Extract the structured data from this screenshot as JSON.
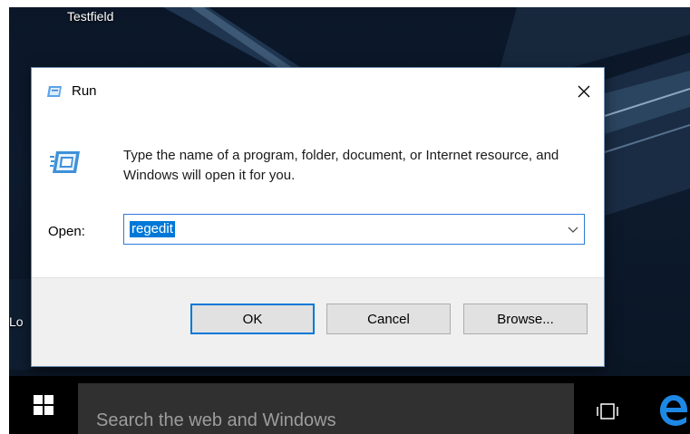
{
  "desktop": {
    "icon_top_label": "Testfield",
    "icon_left_label": "Lo"
  },
  "dialog": {
    "title": "Run",
    "description": "Type the name of a program, folder, document, or Internet resource, and Windows will open it for you.",
    "open_label": "Open:",
    "open_value": "regedit",
    "buttons": {
      "ok": "OK",
      "cancel": "Cancel",
      "browse": "Browse..."
    },
    "close_icon": "close-icon",
    "title_icon": "run-icon"
  },
  "taskbar": {
    "search_placeholder": "Search the web and Windows",
    "start_icon": "windows-logo-icon",
    "taskview_icon": "task-view-icon",
    "edge_icon": "edge-icon"
  },
  "colors": {
    "accent": "#0078d7",
    "taskbar": "#000000",
    "search_box": "#303030"
  }
}
